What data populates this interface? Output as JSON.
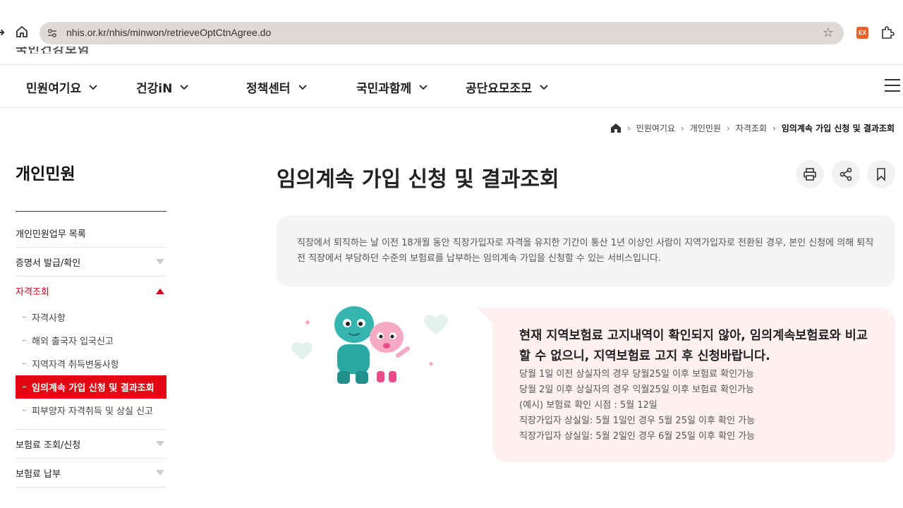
{
  "browser": {
    "url": "nhis.or.kr/nhis/minwon/retrieveOptCtnAgree.do",
    "ext_label": "EX"
  },
  "gnb": {
    "items": [
      "민원여기요",
      "건강iN",
      "정책센터",
      "국민과함께",
      "공단요모조모"
    ]
  },
  "breadcrumb": {
    "items": [
      "민원여기요",
      "개인민원",
      "자격조회"
    ],
    "current": "임의계속 가입 신청 및 결과조회"
  },
  "sidebar": {
    "title": "개인민원",
    "items": [
      {
        "label": "개인민원업무 목록"
      },
      {
        "label": "증명서 발급/확인"
      },
      {
        "label": "자격조회"
      },
      {
        "label": "보험료 조회/신청"
      },
      {
        "label": "보험료 납부"
      }
    ],
    "sub_items": [
      {
        "label": "자격사항"
      },
      {
        "label": "해외 출국자 입국신고"
      },
      {
        "label": "지역자격 취득변동사항"
      },
      {
        "label": "임의계속 가입 신청 및 결과조회"
      },
      {
        "label": "피부양자 자격취득 및 상실 신고"
      }
    ]
  },
  "main": {
    "title": "임의계속 가입 신청 및 결과조회",
    "info_text": "직장에서 퇴직하는 날 이전 18개월 동안 직장가입자로 자격을 유지한 기간이 통산 1년 이상인 사람이 지역가입자로 전환된 경우, 본인 신청에 의해 퇴직 전 직장에서 부담하던 수준의 보험료를 납부하는 임의계속 가입을 신청할 수 있는 서비스입니다.",
    "notice": {
      "headline": "현재 지역보험료 고지내역이 확인되지 않아, 임의계속보험료와 비교할 수 없으니, 지역보험료 고지 후 신청바랍니다.",
      "lines": [
        "당월 1일 이전 상실자의 경우 당월25일 이후 보험료 확인가능",
        "당월 2일 이후 상실자의 경우 익월25일 이후 보험료 확인가능",
        "(예시) 보험료 확인 시점 : 5월 12일",
        "직장가입자 상실일: 5월 1일인 경우 5월 25일 이후 확인 가능",
        "직장가입자 상실일: 5월 2일인 경우 6월 25일 이후 확인 가능"
      ]
    }
  },
  "colors": {
    "accent_red": "#e30613",
    "notice_bg": "#fff1f1",
    "info_bg": "#f5f5f5"
  },
  "icons": [
    "back-arrow-icon",
    "home-icon",
    "site-settings-icon",
    "star-icon",
    "puzzle-icon",
    "chevron-down-icon",
    "hamburger-icon",
    "print-icon",
    "share-icon",
    "bookmark-icon"
  ]
}
